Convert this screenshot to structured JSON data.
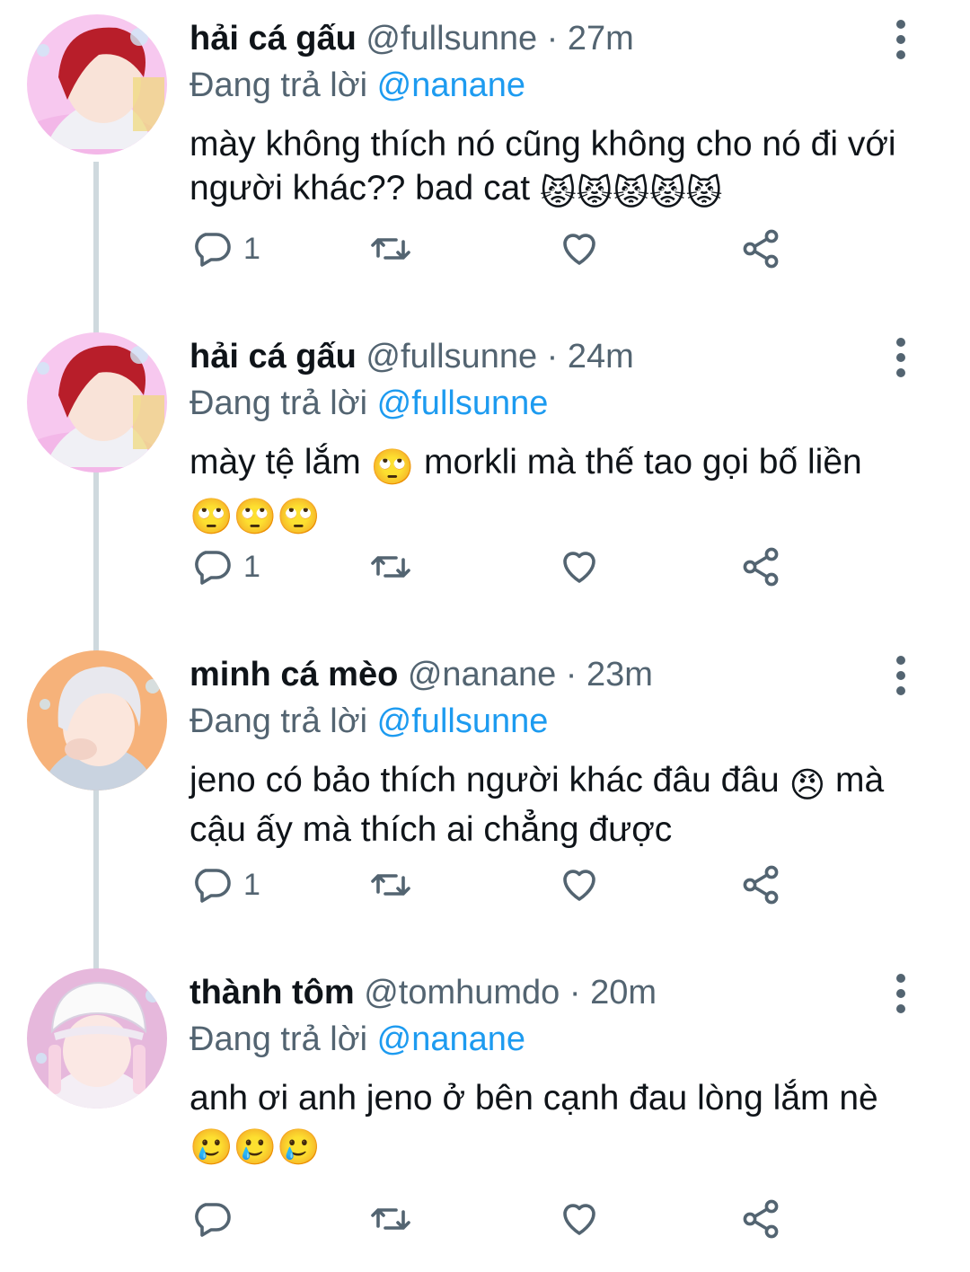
{
  "tweets": [
    {
      "name": "hải cá gấu",
      "handle": "@fullsunne",
      "sep": " · ",
      "time": "27m",
      "reply_prefix": "Đang trả lời ",
      "reply_to": "@nanane",
      "text": "mày không thích nó cũng không cho nó đi với người khác?? bad cat",
      "emoji": [
        "😾",
        "😾",
        "😾",
        "😾",
        "😾"
      ],
      "reply_count": "1",
      "avatar": "red-hair-avatar"
    },
    {
      "name": "hải cá gấu",
      "handle": "@fullsunne",
      "sep": " · ",
      "time": "24m",
      "reply_prefix": "Đang trả lời ",
      "reply_to": "@fullsunne",
      "text_a": "mày tệ lắm ",
      "text_b": " morkli mà thế tao gọi bố liền ",
      "emoji": [
        "🙄",
        "🙄",
        "🙄",
        "🙄"
      ],
      "reply_count": "1",
      "avatar": "red-hair-avatar"
    },
    {
      "name": "minh cá mèo",
      "handle": "@nanane",
      "sep": " · ",
      "time": "23m",
      "reply_prefix": "Đang trả lời ",
      "reply_to": "@fullsunne",
      "text_a": "jeno có bảo thích người khác đâu đâu ",
      "text_b": " mà cậu ấy mà thích ai chẳng được",
      "emoji": [
        "😠"
      ],
      "reply_count": "1",
      "avatar": "white-hair-avatar"
    },
    {
      "name": "thành tôm",
      "handle": "@tomhumdo",
      "sep": " · ",
      "time": "20m",
      "reply_prefix": "Đang trả lời ",
      "reply_to": "@nanane",
      "text": "anh ơi anh jeno ở bên cạnh đau lòng lắm nè ",
      "emoji": [
        "🥲",
        "🥲",
        "🥲"
      ],
      "reply_count": "",
      "avatar": "white-hat-avatar"
    }
  ],
  "colors": {
    "accent": "#1d9bf0",
    "muted": "#536471",
    "text": "#0f1419",
    "thread_line": "#cfd9de"
  },
  "icons": [
    "reply-icon",
    "retweet-icon",
    "like-icon",
    "share-icon",
    "more-options-icon"
  ]
}
